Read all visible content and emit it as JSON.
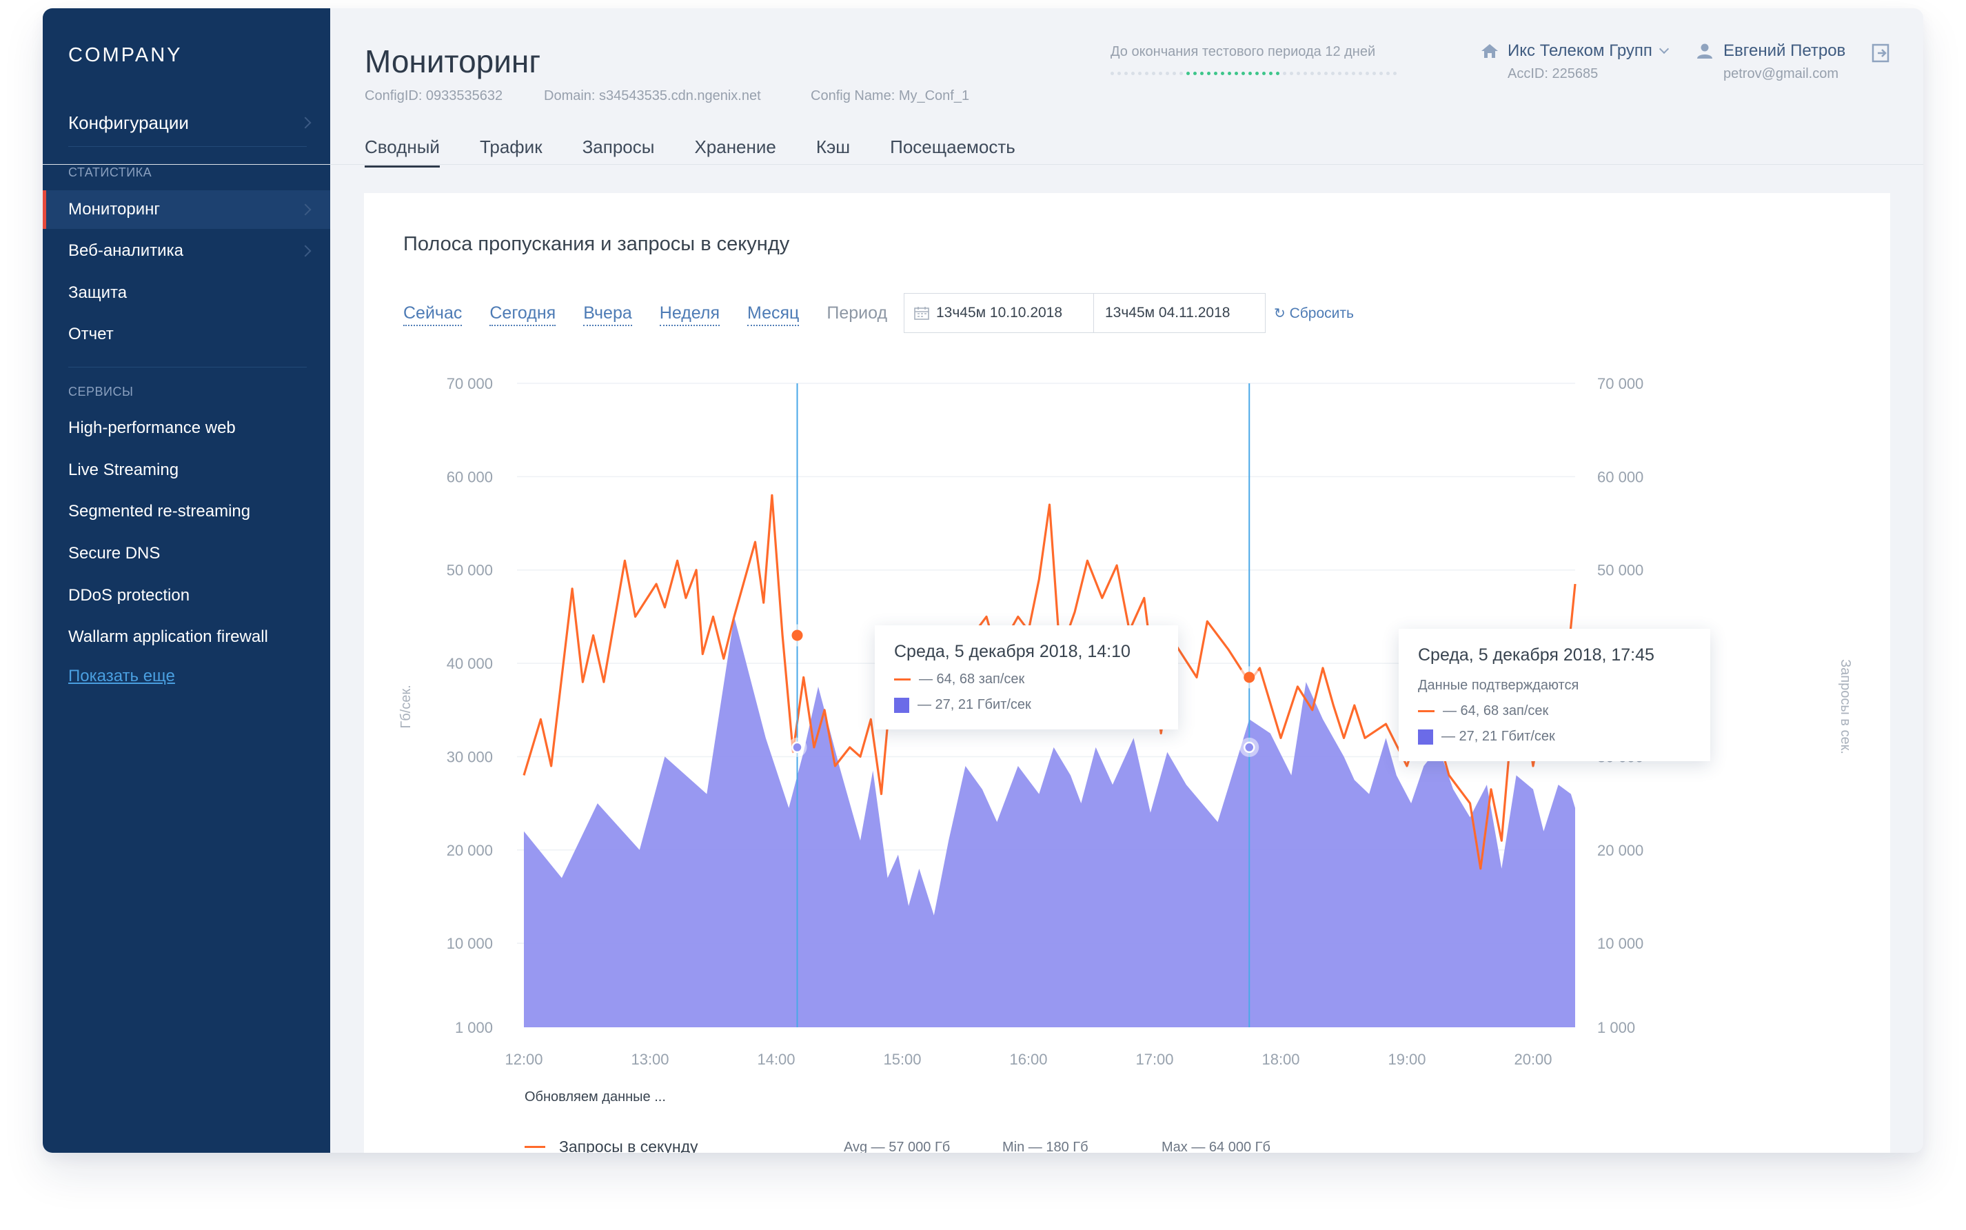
{
  "sidebar": {
    "logo": "COMPANY",
    "config": "Конфигурации",
    "stats_section": "СТАТИСТИКА",
    "stats": [
      "Мониторинг",
      "Веб-аналитика",
      "Защита",
      "Отчет"
    ],
    "services_section": "СЕРВИСЫ",
    "services": [
      "High-performance web",
      "Live Streaming",
      "Segmented re-streaming",
      "Secure DNS",
      "DDoS protection",
      "Wallarm application firewall"
    ],
    "more": "Показать еще"
  },
  "header": {
    "title": "Мониторинг",
    "config_id": "ConfigID: 0933535632",
    "domain": "Domain: s34543535.cdn.ngenix.net",
    "config_name": "Config Name: My_Conf_1",
    "trial": "До окончания тестового периода 12 дней",
    "trial_progress": 0.6,
    "org_name": "Икс Телеком Групп",
    "org_acc": "AccID: 225685",
    "user_name": "Евгений Петров",
    "user_email": "petrov@gmail.com"
  },
  "tabs": [
    "Сводный",
    "Трафик",
    "Запросы",
    "Хранение",
    "Кэш",
    "Посещаемость"
  ],
  "active_tab": "Сводный",
  "card": {
    "title": "Полоса пропускания и запросы в секунду",
    "filters": [
      "Сейчас",
      "Сегодня",
      "Вчера",
      "Неделя",
      "Месяц"
    ],
    "period_label": "Период",
    "date_from": "13ч45м 10.10.2018",
    "date_to": "13ч45м 04.11.2018",
    "reset": "Сбросить",
    "updating": "Обновляем данные ...",
    "legend_label": "Запросы в секунду",
    "avg": "Avg — 57 000 Гб",
    "min": "Min — 180 Гб",
    "max": "Max — 64 000 Гб"
  },
  "tooltips": [
    {
      "title": "Среда, 5 декабря 2018, 14:10",
      "note": "",
      "req": "— 64, 68 зап/сек",
      "bw": "— 27, 21 Гбит/сек"
    },
    {
      "title": "Среда, 5 декабря 2018, 17:45",
      "note": "Данные подтверждаются",
      "req": "— 64, 68 зап/сек",
      "bw": "— 27, 21 Гбит/сек"
    }
  ],
  "colors": {
    "line": "#ff6a2b",
    "area": "#8f8ff0",
    "crosshair": "#4aa8e8",
    "sidebar": "#133560"
  },
  "chart_data": {
    "type": "line",
    "x_categories": [
      "12:00",
      "13:00",
      "14:00",
      "15:00",
      "16:00",
      "17:00",
      "18:00",
      "19:00",
      "20:00"
    ],
    "y_ticks": [
      "70 000",
      "60 000",
      "50 000",
      "40 000",
      "30 000",
      "20 000",
      "10 000",
      "1 000"
    ],
    "ylabel": "Гб/сек.",
    "ylabel_right": "Запросы в сек.",
    "ylim": [
      1000,
      70000
    ],
    "x_range": [
      "12:00",
      "20:20"
    ],
    "grid": true,
    "series": [
      {
        "name": "Запросы в секунду",
        "kind": "line",
        "x": [
          "12:00",
          "12:08",
          "12:13",
          "12:23",
          "12:28",
          "12:33",
          "12:38",
          "12:48",
          "12:53",
          "13:03",
          "13:07",
          "13:13",
          "13:17",
          "13:22",
          "13:25",
          "13:30",
          "13:35",
          "13:40",
          "13:50",
          "13:54",
          "13:58",
          "14:03",
          "14:08",
          "14:13",
          "14:18",
          "14:23",
          "14:28",
          "14:35",
          "14:40",
          "14:45",
          "14:50",
          "14:55",
          "15:00",
          "15:05",
          "15:10",
          "15:15",
          "15:20",
          "15:25",
          "15:30",
          "15:35",
          "15:40",
          "15:45",
          "15:50",
          "15:55",
          "16:00",
          "16:05",
          "16:10",
          "16:15",
          "16:22",
          "16:28",
          "16:35",
          "16:42",
          "16:48",
          "16:55",
          "17:03",
          "17:10",
          "17:20",
          "17:25",
          "17:35",
          "17:45",
          "17:50",
          "18:00",
          "18:08",
          "18:15",
          "18:20",
          "18:25",
          "18:30",
          "18:35",
          "18:40",
          "18:50",
          "19:00",
          "19:10",
          "19:20",
          "19:30",
          "19:35",
          "19:40",
          "19:45",
          "19:50",
          "19:55",
          "20:00",
          "20:05",
          "20:12",
          "20:20"
        ],
        "y": [
          28000,
          34000,
          29000,
          48000,
          38000,
          43000,
          38000,
          51000,
          45000,
          48500,
          46000,
          51000,
          47000,
          50000,
          41000,
          45000,
          40500,
          45000,
          53000,
          46500,
          58000,
          43000,
          30500,
          38500,
          31000,
          35000,
          29000,
          31000,
          30000,
          34000,
          26000,
          38500,
          39000,
          43000,
          36500,
          33500,
          40500,
          41500,
          37000,
          43500,
          45000,
          41000,
          43000,
          45000,
          43500,
          49000,
          57000,
          41000,
          45500,
          51000,
          47000,
          50500,
          43500,
          47000,
          32500,
          42000,
          38500,
          44500,
          41500,
          38000,
          39500,
          32000,
          37500,
          35000,
          39500,
          35500,
          32000,
          35500,
          32000,
          33500,
          29000,
          36000,
          28000,
          25000,
          18000,
          26500,
          21000,
          34000,
          36500,
          29000,
          35000,
          30500,
          48500
        ]
      },
      {
        "name": "Полоса пропускания",
        "kind": "area",
        "x": [
          "12:00",
          "12:18",
          "12:35",
          "12:55",
          "13:07",
          "13:27",
          "13:40",
          "13:55",
          "14:06",
          "14:13",
          "14:20",
          "14:30",
          "14:40",
          "14:46",
          "14:53",
          "14:58",
          "15:03",
          "15:08",
          "15:15",
          "15:22",
          "15:30",
          "15:38",
          "15:45",
          "15:55",
          "16:05",
          "16:12",
          "16:20",
          "16:25",
          "16:32",
          "16:40",
          "16:50",
          "16:58",
          "17:06",
          "17:15",
          "17:30",
          "17:45",
          "17:55",
          "18:05",
          "18:12",
          "18:20",
          "18:30",
          "18:35",
          "18:42",
          "18:50",
          "18:55",
          "19:02",
          "19:08",
          "19:15",
          "19:22",
          "19:30",
          "19:38",
          "19:45",
          "19:52",
          "20:00",
          "20:05",
          "20:12",
          "20:18",
          "20:20"
        ],
        "y": [
          22000,
          17000,
          25000,
          20000,
          30000,
          26000,
          45000,
          32000,
          24500,
          30500,
          37500,
          29000,
          21000,
          28500,
          17000,
          19500,
          14000,
          18000,
          13000,
          21000,
          29000,
          26500,
          23000,
          29000,
          26000,
          31000,
          28000,
          25000,
          31000,
          27000,
          32000,
          24000,
          30500,
          27000,
          23000,
          34000,
          32500,
          28000,
          38000,
          34000,
          30000,
          27500,
          26000,
          32000,
          28000,
          25000,
          29000,
          31000,
          26500,
          23500,
          27000,
          18000,
          28000,
          26500,
          22000,
          27000,
          26000,
          24500
        ]
      }
    ]
  }
}
